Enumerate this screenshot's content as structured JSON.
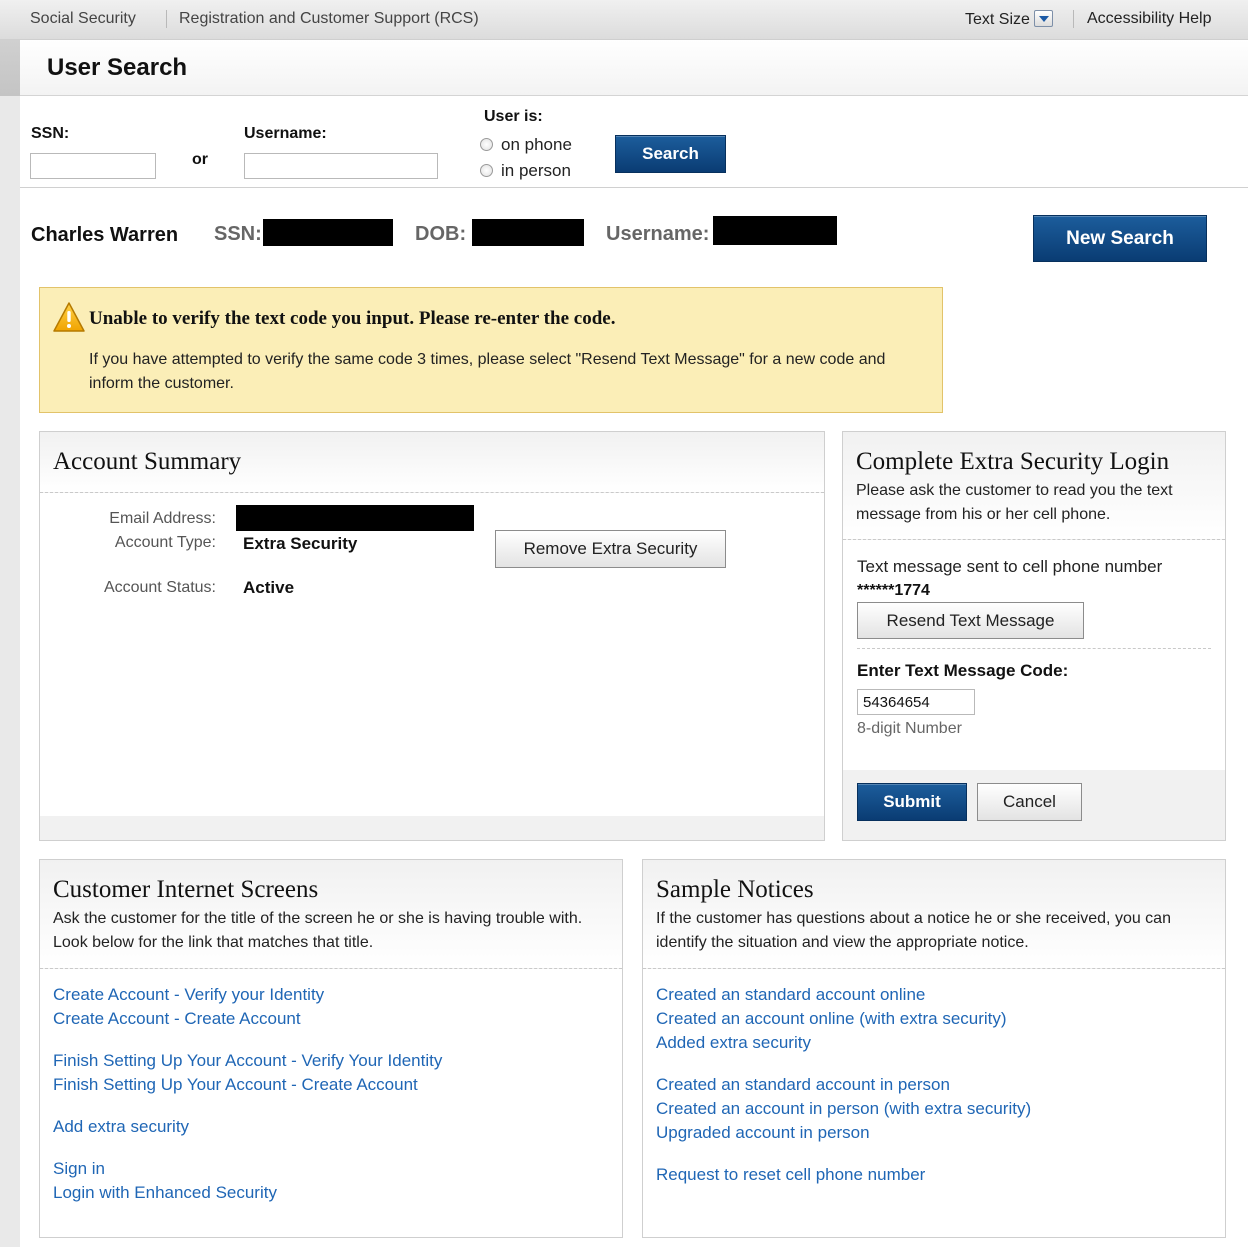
{
  "topbar": {
    "crumb_home": "Social Security",
    "crumb_app": "Registration and Customer Support (RCS)",
    "text_size": "Text Size",
    "accessibility": "Accessibility Help"
  },
  "page_title": "User Search",
  "search": {
    "ssn_label": "SSN:",
    "or_label": "or",
    "username_label": "Username:",
    "user_is_label": "User is:",
    "opt_phone": "on phone",
    "opt_person": "in person",
    "search_button": "Search",
    "ssn_value": "",
    "username_value": ""
  },
  "user": {
    "name": "Charles Warren",
    "ssn_label": "SSN:",
    "dob_label": "DOB:",
    "username_label": "Username:",
    "new_search_button": "New Search"
  },
  "alert": {
    "title": "Unable to verify the text code you input. Please re-enter the code.",
    "body": "If you have attempted to verify the same code 3 times, please select \"Resend Text Message\" for a new code and inform the customer."
  },
  "account_summary": {
    "title": "Account Summary",
    "email_label": "Email Address:",
    "type_label": "Account Type:",
    "type_value": "Extra Security",
    "status_label": "Account Status:",
    "status_value": "Active",
    "remove_button": "Remove Extra Security"
  },
  "extra_security": {
    "title": "Complete Extra Security Login",
    "subtitle": "Please ask the customer to read you the text message from his or her cell phone.",
    "sent_text": "Text message sent to cell phone number",
    "phone_masked": "******1774",
    "resend_button": "Resend Text Message",
    "code_label": "Enter Text Message Code:",
    "code_value": "54364654",
    "code_hint": "8-digit Number",
    "submit_button": "Submit",
    "cancel_button": "Cancel"
  },
  "customer_screens": {
    "title": "Customer Internet Screens",
    "subtitle": "Ask the customer for the title of the screen he or she is having trouble with. Look below for the link that matches that title.",
    "links": [
      "Create Account - Verify your Identity",
      "Create Account - Create Account",
      "Finish Setting Up Your Account - Verify Your Identity",
      "Finish Setting Up Your Account - Create Account",
      "Add extra security",
      "Sign in",
      "Login with Enhanced Security"
    ]
  },
  "sample_notices": {
    "title": "Sample Notices",
    "subtitle": "If the customer has questions about a notice he or she received, you can identify the situation and view the appropriate notice.",
    "links": [
      "Created an standard account online",
      "Created an account online (with extra security)",
      "Added extra security",
      "Created an standard account in person",
      "Created an account in person (with extra security)",
      "Upgraded account in person",
      "Request to reset cell phone number"
    ]
  }
}
